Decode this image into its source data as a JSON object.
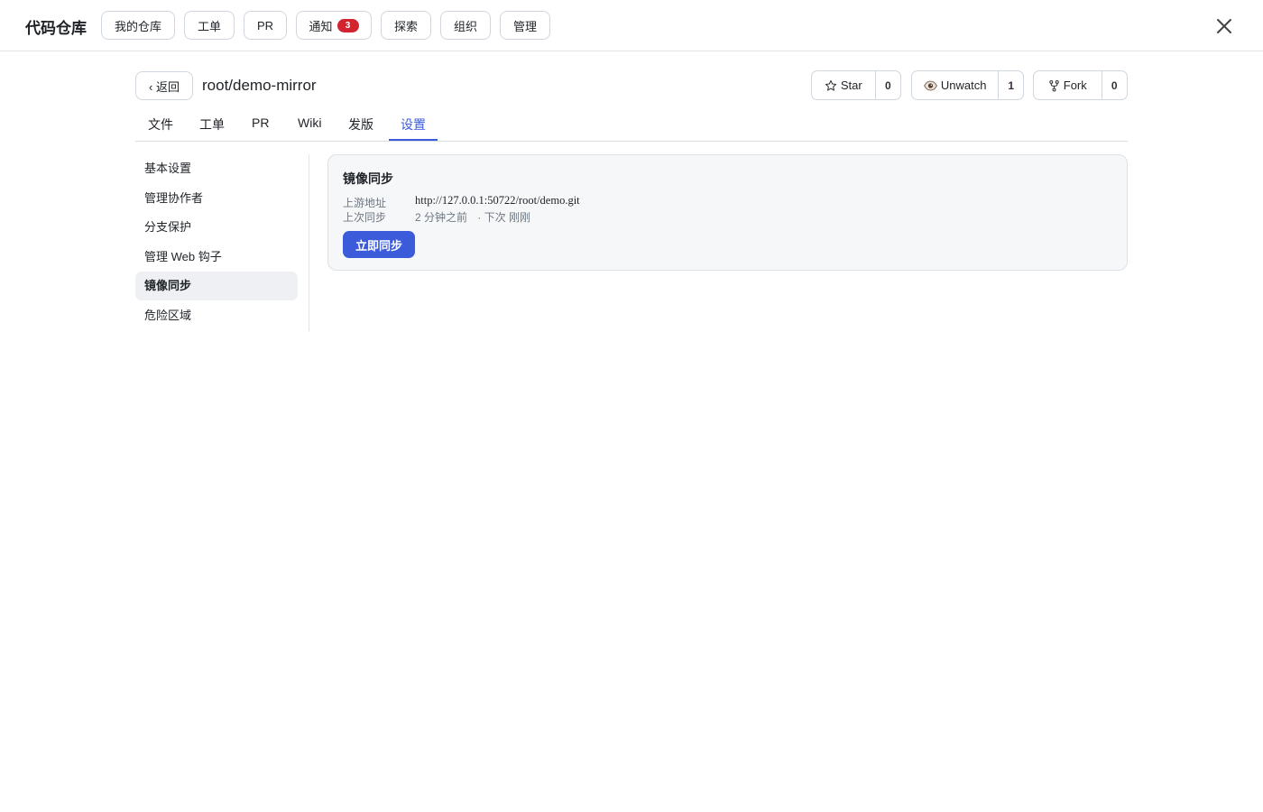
{
  "app": {
    "title": "代码仓库"
  },
  "nav": {
    "my_repos": "我的仓库",
    "issues": "工单",
    "pr": "PR",
    "notifications": "通知",
    "notification_count": "3",
    "explore": "探索",
    "orgs": "组织",
    "admin": "管理"
  },
  "repo": {
    "back_label": "‹ 返回",
    "name": "root/demo-mirror",
    "star_label": "Star",
    "star_count": "0",
    "watch_label": "Unwatch",
    "watch_count": "1",
    "fork_label": "Fork",
    "fork_count": "0"
  },
  "tabs": [
    "文件",
    "工单",
    "PR",
    "Wiki",
    "发版",
    "设置"
  ],
  "active_tab": "设置",
  "settings_menu": [
    "基本设置",
    "管理协作者",
    "分支保护",
    "管理 Web 钩子",
    "镜像同步",
    "危险区域"
  ],
  "active_menu": "镜像同步",
  "mirror": {
    "title": "镜像同步",
    "upstream_label": "上游地址",
    "upstream_url": "http://127.0.0.1:50722/root/demo.git",
    "last_sync_label": "上次同步",
    "last_sync": "2 分钟之前",
    "next_sync": "· 下次 刚刚",
    "sync_button": "立即同步"
  },
  "colors": {
    "accent": "#3b5bdb",
    "badge": "#d1242f",
    "card_bg": "#f6f7f9"
  },
  "icons": {
    "close": "close-icon",
    "star": "star-icon",
    "watch": "eye-icon",
    "fork": "fork-icon"
  }
}
